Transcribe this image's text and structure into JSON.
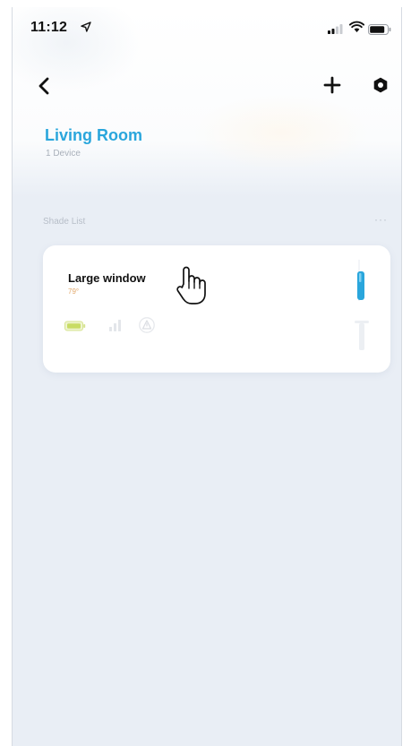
{
  "status": {
    "time": "11:12"
  },
  "header": {
    "back_icon": "chevron-left-icon",
    "add_icon": "plus-icon",
    "settings_icon": "hexagon-settings-icon"
  },
  "room": {
    "title": "Living Room",
    "subtitle": "1 Device"
  },
  "section": {
    "label": "Shade List",
    "more": "···"
  },
  "devices": [
    {
      "name": "Large window",
      "temperature": "79°",
      "battery_icon": "battery-icon",
      "signal_icon": "signal-bars-icon",
      "warning_icon": "warning-triangle-icon"
    }
  ],
  "colors": {
    "accent": "#2aa6dc",
    "background": "#e9eef5",
    "battery_green": "#c8dc64",
    "temp": "#e2a86b"
  }
}
